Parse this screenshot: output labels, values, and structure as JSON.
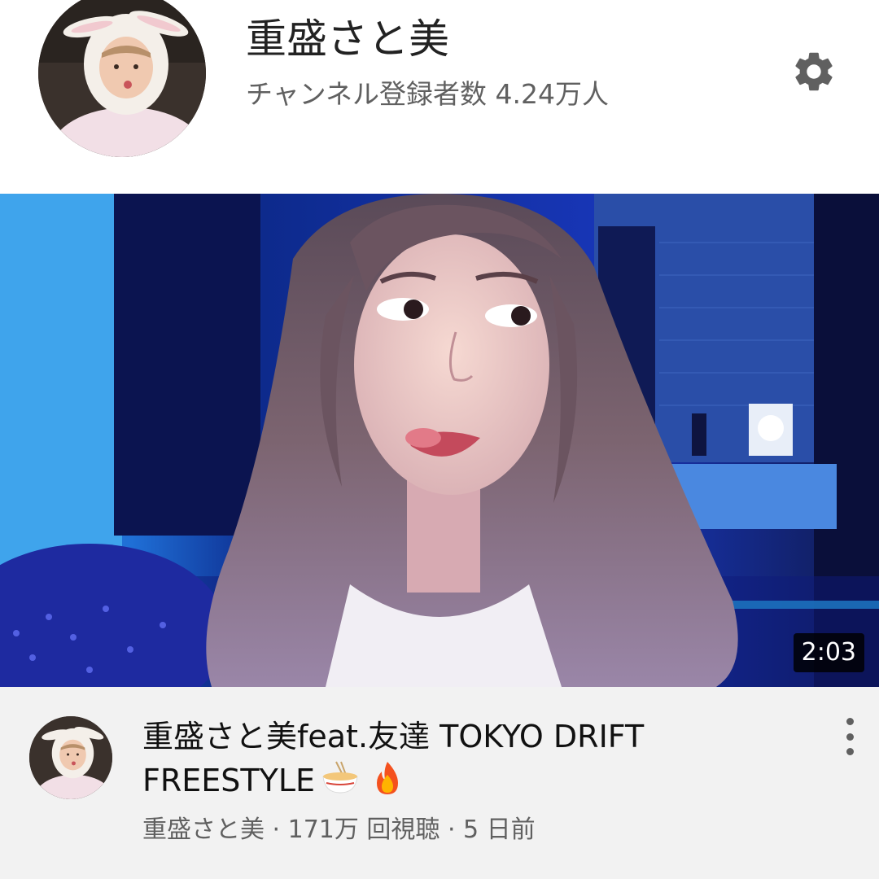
{
  "channel": {
    "name": "重盛さと美",
    "subscribers": "チャンネル登録者数 4.24万人",
    "avatar_icon": "channel-avatar-bunny-hood"
  },
  "header": {
    "settings_icon": "gear-icon"
  },
  "video": {
    "duration": "2:03",
    "title": "重盛さと美feat.友達 TOKYO DRIFT FREESTYLE",
    "title_emojis": [
      "ramen-emoji",
      "fire-emoji"
    ],
    "meta": {
      "channel": "重盛さと美",
      "views": "171万 回視聴",
      "age": "5 日前",
      "separator": " · "
    },
    "menu_icon": "more-vert-icon"
  },
  "colors": {
    "background": "#ffffff",
    "info_background": "#f2f2f2",
    "secondary_text": "#606060",
    "primary_text": "#111111",
    "thumbnail_tint": "#1a3cff"
  }
}
